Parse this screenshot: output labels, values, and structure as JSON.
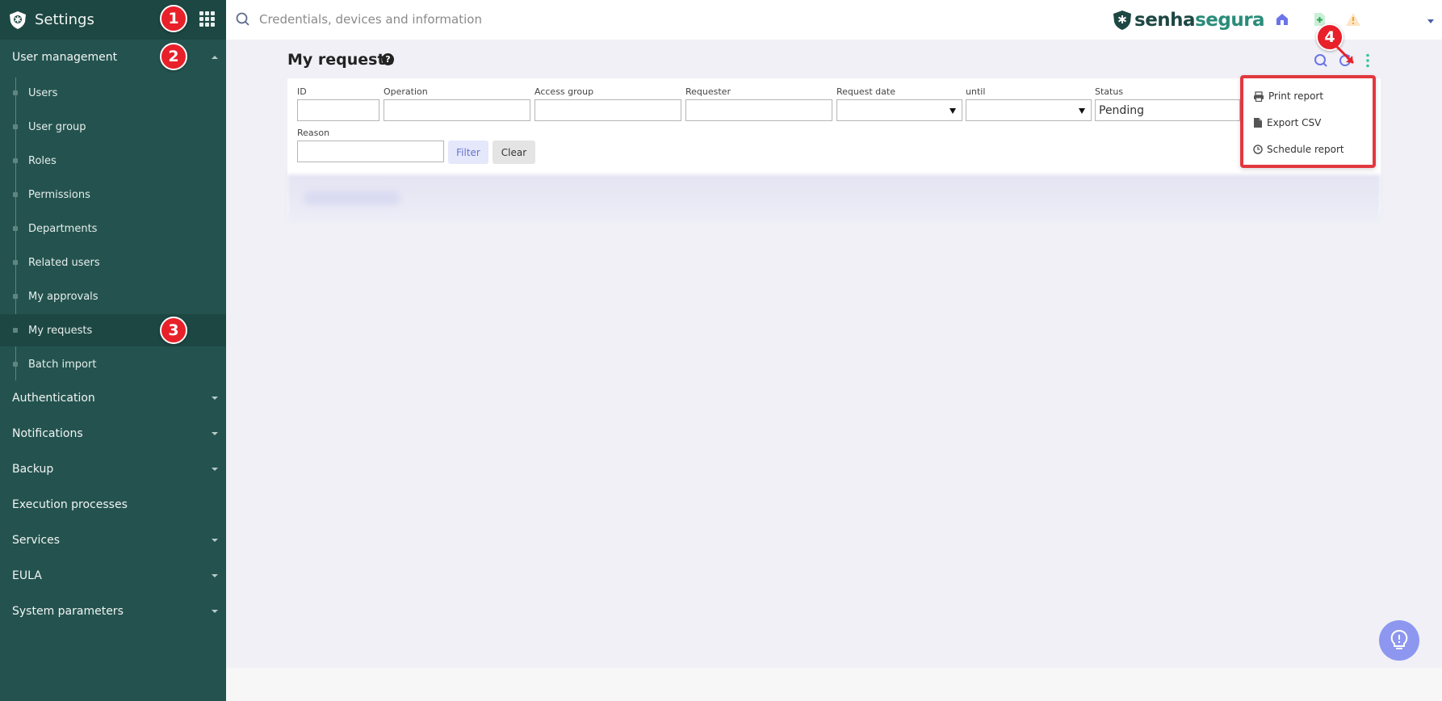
{
  "app": {
    "title": "Settings"
  },
  "search": {
    "placeholder": "Credentials, devices and information"
  },
  "brand": {
    "part1": "senha",
    "part2": "segura"
  },
  "sidebar": {
    "sections": [
      {
        "label": "User management",
        "expanded": true
      },
      {
        "label": "Authentication",
        "expanded": false
      },
      {
        "label": "Notifications",
        "expanded": false
      },
      {
        "label": "Backup",
        "expanded": false
      },
      {
        "label": "Execution processes",
        "expanded": false
      },
      {
        "label": "Services",
        "expanded": false
      },
      {
        "label": "EULA",
        "expanded": false
      },
      {
        "label": "System parameters",
        "expanded": false
      }
    ],
    "items": [
      {
        "label": "Users"
      },
      {
        "label": "User group"
      },
      {
        "label": "Roles"
      },
      {
        "label": "Permissions"
      },
      {
        "label": "Departments"
      },
      {
        "label": "Related users"
      },
      {
        "label": "My approvals"
      },
      {
        "label": "My requests",
        "active": true
      },
      {
        "label": "Batch import"
      }
    ]
  },
  "page": {
    "title": "My requests"
  },
  "filters": {
    "id_label": "ID",
    "operation_label": "Operation",
    "access_group_label": "Access group",
    "requester_label": "Requester",
    "request_date_label": "Request date",
    "until_label": "until",
    "status_label": "Status",
    "status_value": "Pending",
    "reason_label": "Reason",
    "filter_button": "Filter",
    "clear_button": "Clear"
  },
  "menu": {
    "items": [
      {
        "label": "Print report",
        "icon": "printer-icon"
      },
      {
        "label": "Export CSV",
        "icon": "file-icon"
      },
      {
        "label": "Schedule report",
        "icon": "clock-icon"
      }
    ]
  },
  "annotations": {
    "step1": "1",
    "step2": "2",
    "step3": "3",
    "step4": "4"
  },
  "colors": {
    "sidebar_bg": "#24534f",
    "sidebar_dark": "#1d4743",
    "accent": "#6574cd",
    "highlight_border": "#e2383f",
    "badge": "#e8202a"
  }
}
